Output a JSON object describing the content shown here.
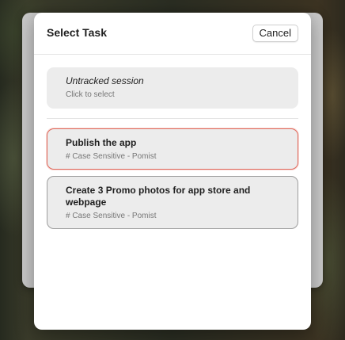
{
  "dialog": {
    "title": "Select Task",
    "cancel_label": "Cancel"
  },
  "untracked": {
    "title": "Untracked session",
    "subtitle": "Click to select"
  },
  "tasks": [
    {
      "title": "Publish the app",
      "project": "# Case Sensitive - Pomist",
      "highlight_color": "#e06a5d"
    },
    {
      "title": "Create 3 Promo photos for app store and webpage",
      "project": "# Case Sensitive - Pomist"
    }
  ]
}
